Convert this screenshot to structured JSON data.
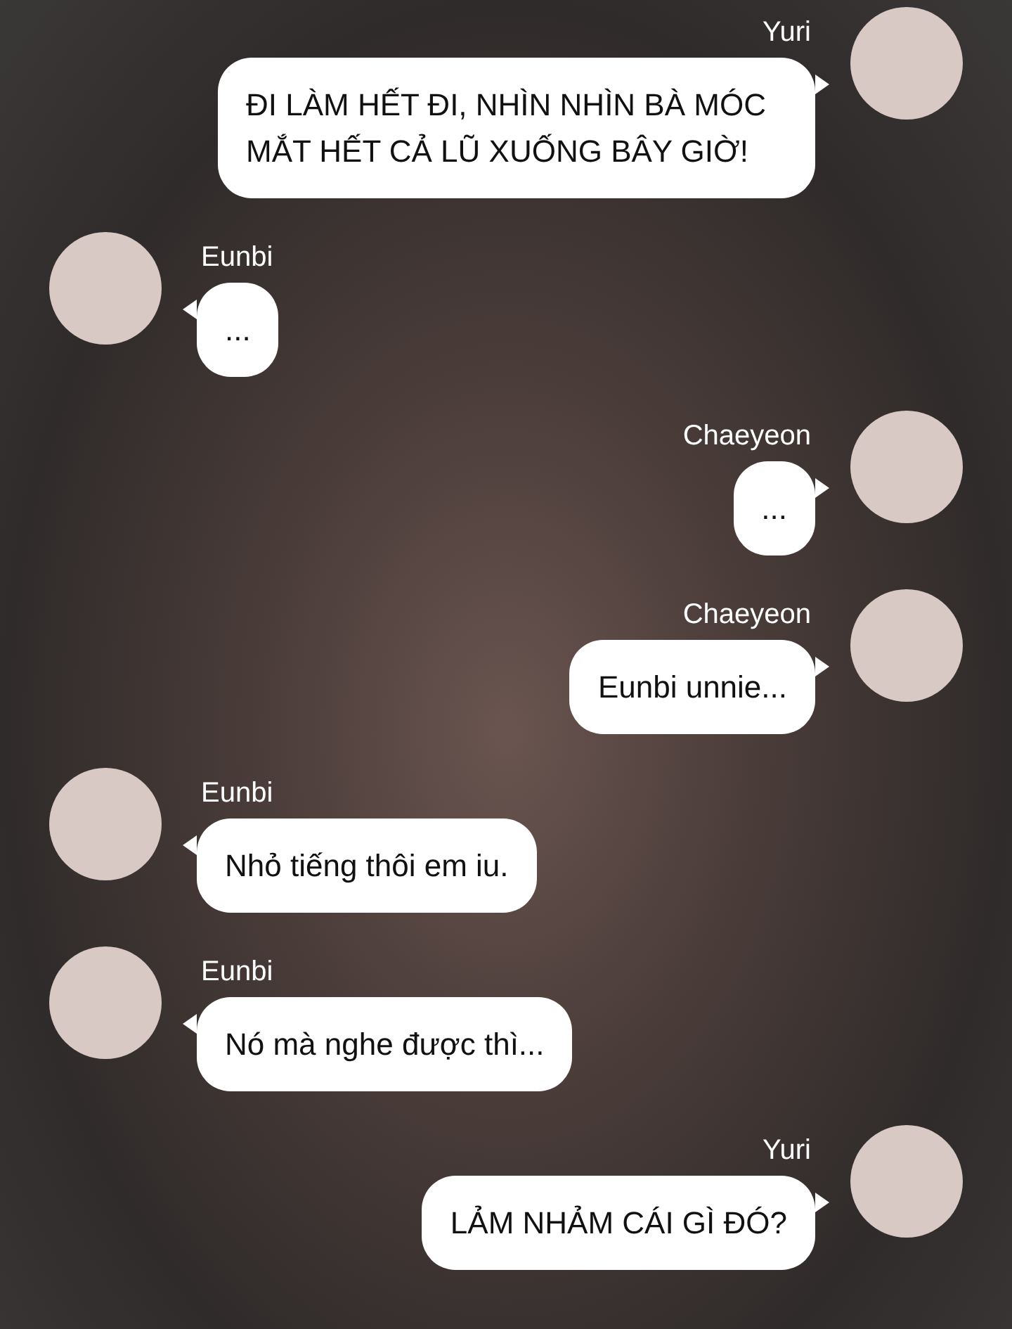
{
  "messages": [
    {
      "sender": "Yuri",
      "outgoing": true,
      "text": "ĐI LÀM HẾT ĐI, NHÌN NHÌN BÀ MÓC MẮT HẾT CẢ LŨ XUỐNG BÂY GIỜ!"
    },
    {
      "sender": "Eunbi",
      "outgoing": false,
      "text": "..."
    },
    {
      "sender": "Chaeyeon",
      "outgoing": true,
      "text": "..."
    },
    {
      "sender": "Chaeyeon",
      "outgoing": true,
      "text": "Eunbi unnie..."
    },
    {
      "sender": "Eunbi",
      "outgoing": false,
      "text": "Nhỏ tiếng thôi em iu."
    },
    {
      "sender": "Eunbi",
      "outgoing": false,
      "text": "Nó mà nghe được thì..."
    },
    {
      "sender": "Yuri",
      "outgoing": true,
      "text": "LẢM NHẢM CÁI GÌ ĐÓ?"
    }
  ]
}
